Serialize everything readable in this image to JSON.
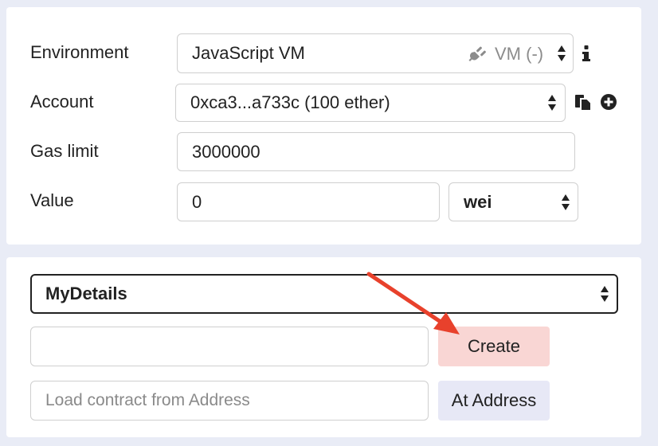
{
  "settings": {
    "environment": {
      "label": "Environment",
      "value": "JavaScript VM",
      "badge_icon": "plug-icon",
      "badge": "VM (-)",
      "info_icon": "info-icon"
    },
    "account": {
      "label": "Account",
      "value": "0xca3...a733c (100 ether)",
      "copy_icon": "copy-icon",
      "add_icon": "plus-circle-icon"
    },
    "gas_limit": {
      "label": "Gas limit",
      "value": "3000000"
    },
    "value": {
      "label": "Value",
      "amount": "0",
      "unit": "wei"
    }
  },
  "deploy": {
    "contract": "MyDetails",
    "constructor_args": {
      "value": "",
      "placeholder": ""
    },
    "create_label": "Create",
    "create_color": "#f9d6d4",
    "address_input": {
      "value": "",
      "placeholder": "Load contract from Address"
    },
    "at_address_label": "At Address",
    "at_address_color": "#e7e8f6"
  },
  "annotation": {
    "arrow_color": "#e8412c"
  }
}
